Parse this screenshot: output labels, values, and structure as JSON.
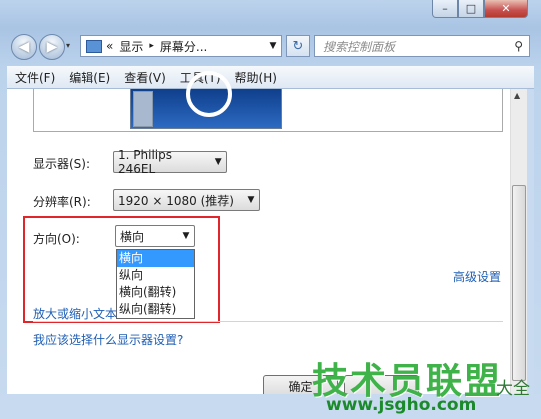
{
  "window": {
    "caption": {
      "minimize": "–",
      "maximize": "□",
      "close": "✕"
    },
    "nav": {
      "back_icon": "back-arrow-icon",
      "forward_icon": "forward-arrow-icon",
      "history_arrow": "▾"
    },
    "address": {
      "chevrons": "«",
      "crumb1": "显示",
      "sep": "▸",
      "crumb2": "屏幕分...",
      "dropdown_arrow": "▼"
    },
    "refresh_glyph": "↻",
    "search": {
      "placeholder": "搜索控制面板",
      "icon": "⚲"
    }
  },
  "menu": [
    "文件(F)",
    "编辑(E)",
    "查看(V)",
    "工具(T)",
    "帮助(H)"
  ],
  "scroll": {
    "up": "▲"
  },
  "settings": {
    "display_label": "显示器(S):",
    "display_value": "1. Philips 246EL",
    "resolution_label": "分辨率(R):",
    "resolution_value": "1920 × 1080 (推荐)",
    "orientation_label": "方向(O):",
    "orientation_value": "横向",
    "combo_arrow": "▼",
    "orientation_options": [
      "横向",
      "纵向",
      "横向(翻转)",
      "纵向(翻转)"
    ],
    "advanced_link": "高级设置",
    "enlarge_link": "放大或缩小文本",
    "which_settings_link": "我应该选择什么显示器设置?"
  },
  "buttons": {
    "ok": "确定"
  },
  "watermark": {
    "main": "技术员联盟",
    "url": "www.jsgho.com",
    "side": "大全"
  },
  "colors": {
    "highlight": "#3399ff",
    "link": "#1f5fb4",
    "callout": "#e0262a",
    "watermark": "#3fb349"
  }
}
